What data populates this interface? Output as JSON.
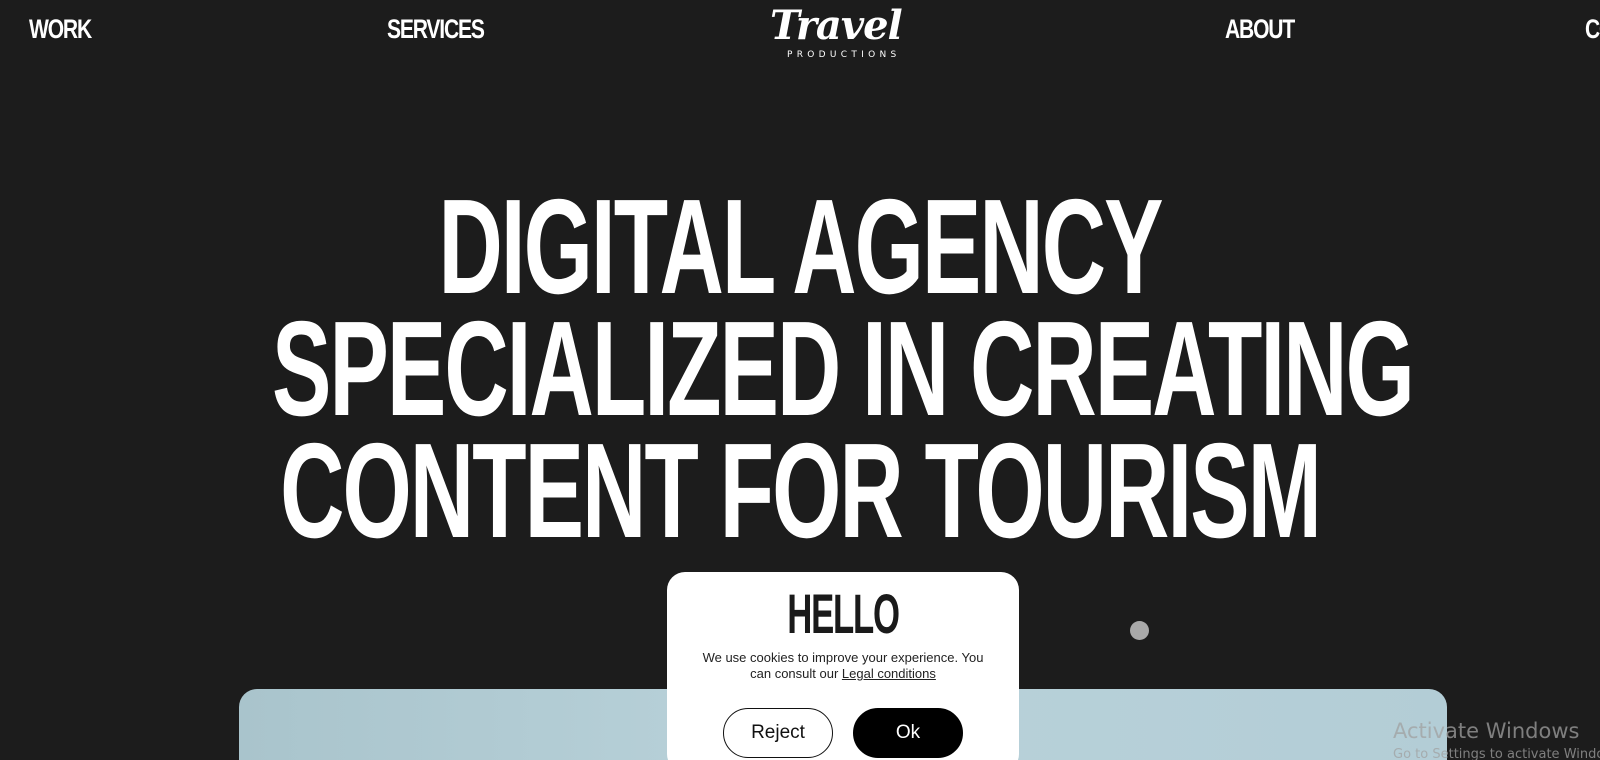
{
  "nav": {
    "work": "WORK",
    "services": "SERVICES",
    "about": "ABOUT",
    "contact": "CO"
  },
  "logo": {
    "script": "Travel",
    "sub": "PRODUCTIONS"
  },
  "hero": {
    "lines": [
      "DIGITAL AGENCY",
      "SPECIALIZED IN CREATING",
      "CONTENT FOR TOURISM"
    ]
  },
  "cookie": {
    "title": "HELLO",
    "text_before": "We use cookies to improve your experience. You can consult our ",
    "link": "Legal conditions",
    "reject": "Reject",
    "ok": "Ok"
  },
  "watermark": {
    "title": "Activate Windows",
    "sub": "Go to Settings to activate Windows."
  },
  "colors": {
    "background": "#1c1c1c",
    "text": "#ffffff",
    "modal": "#ffffff",
    "ok_button": "#000000"
  }
}
